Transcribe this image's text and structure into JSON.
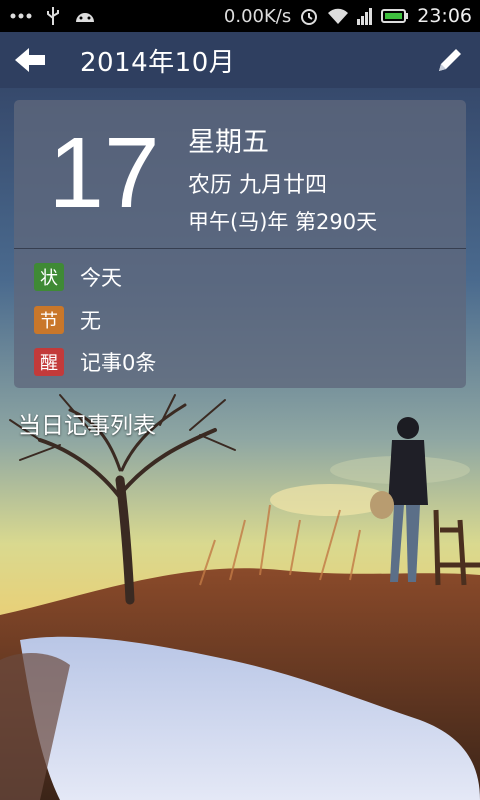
{
  "status_bar": {
    "network_speed": "0.00K/s",
    "time": "23:06",
    "icons": [
      "more-dots-icon",
      "usb-icon",
      "android-icon",
      "alarm-icon",
      "wifi-icon",
      "signal-icon",
      "battery-icon"
    ],
    "battery_color": "#3fbf3f"
  },
  "header": {
    "title": "2014年10月",
    "back_icon": "back-arrow-icon",
    "edit_icon": "pencil-icon"
  },
  "date_card": {
    "day": "17",
    "weekday": "星期五",
    "lunar": "农历 九月廿四",
    "ganzhi": "甲午(马)年 第290天",
    "rows": [
      {
        "badge": "状",
        "badge_color": "#3f8a35",
        "text": "今天"
      },
      {
        "badge": "节",
        "badge_color": "#c9772a",
        "text": "无"
      },
      {
        "badge": "醒",
        "badge_color": "#c33a3a",
        "text": "记事0条"
      }
    ]
  },
  "list_header": "当日记事列表"
}
